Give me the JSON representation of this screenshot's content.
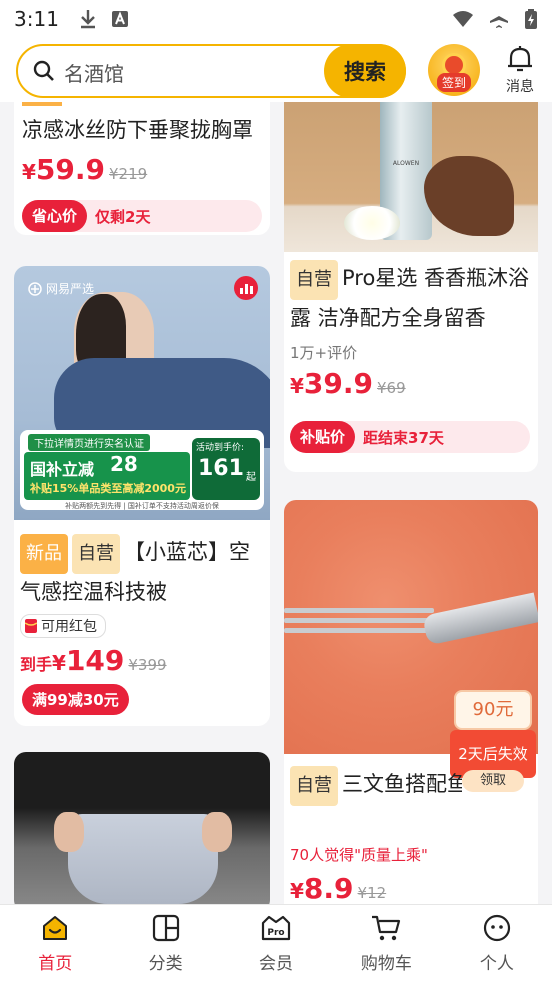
{
  "status": {
    "time": "3:11"
  },
  "search": {
    "placeholder": "名酒馆",
    "button": "搜索"
  },
  "header": {
    "signin_label": "签到",
    "message_label": "消息"
  },
  "cards": {
    "c1": {
      "title": "凉感冰丝防下垂聚拢胸罩",
      "price_yen": "¥",
      "price": "59.9",
      "old_price": "¥219",
      "badge": "省心价",
      "badge_note": "仅剩2天"
    },
    "c2": {
      "tags": [
        "自营"
      ],
      "title": "Pro星选 香香瓶沐浴露 洁净配方全身留香",
      "reviews": "1万+评价",
      "price_yen": "¥",
      "price": "39.9",
      "old_price": "¥69",
      "badge": "补贴价",
      "badge_note": "距结束37天",
      "bottle_label": "ALOWEN"
    },
    "c3": {
      "brand": "网易严选",
      "banner_top": "下拉详情页进行实名认证",
      "subsidy": "国补立减",
      "subsidy_value": "28",
      "subsidy_sub": "补贴15%单品类至高减2000元",
      "price_title": "活动到手价:",
      "price_value": "161",
      "price_suffix": "起",
      "fine_print": "补贴两额先到先得 | 国补订单不支持活动周返价保",
      "tags": [
        "新品",
        "自营"
      ],
      "title": "【小蓝芯】空气感控温科技被",
      "coupon_tag": "可用红包",
      "price_prefix": "到手",
      "price_yen": "¥",
      "price": "149",
      "old_price": "¥399",
      "promo": "满99减30元"
    },
    "c4": {
      "coupon_value": "90元",
      "coupon_expire": "2天后失效",
      "coupon_claim": "领取",
      "tags": [
        "自营"
      ],
      "title": "三文鱼搭配鱼 猫用无谷慕斯罐头",
      "praise": "70人觉得\"质量上乘\"",
      "price_yen": "¥",
      "price": "8.9",
      "old_price": "¥12"
    }
  },
  "tabs": [
    {
      "label": "首页",
      "icon": "home-icon"
    },
    {
      "label": "分类",
      "icon": "category-icon"
    },
    {
      "label": "会员",
      "icon": "pro-member-icon"
    },
    {
      "label": "购物车",
      "icon": "cart-icon"
    },
    {
      "label": "个人",
      "icon": "profile-icon"
    }
  ],
  "colors": {
    "accent": "#f5b400",
    "price_red": "#e8213a"
  }
}
